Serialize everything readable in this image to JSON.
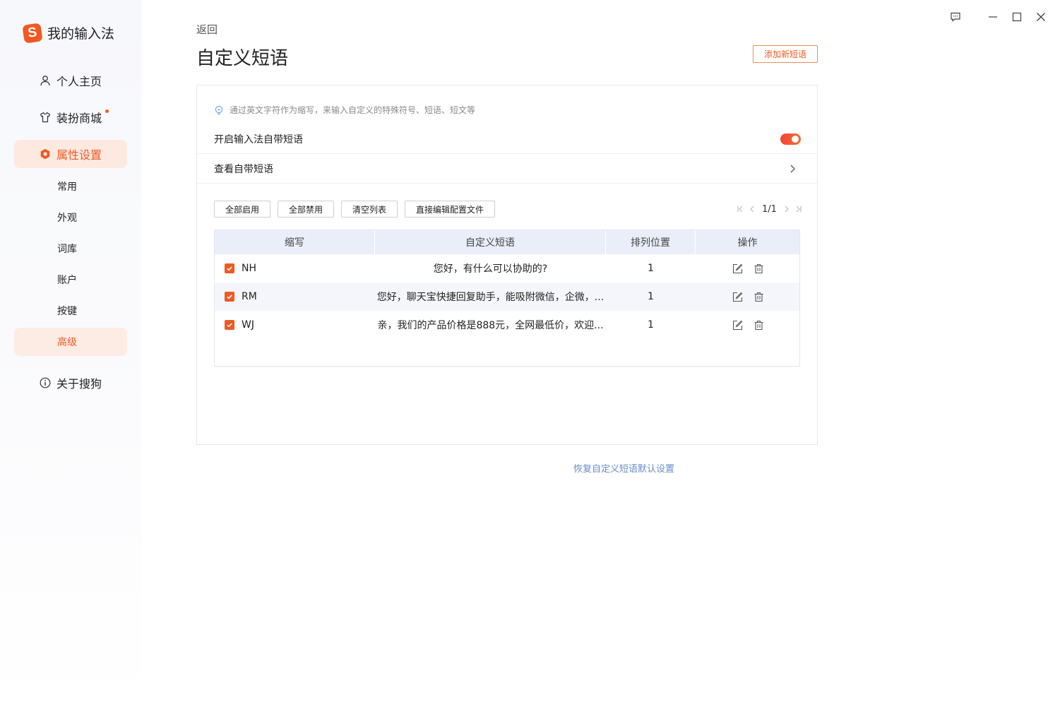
{
  "app": {
    "name": "我的输入法",
    "logo_letter": "S"
  },
  "sidebar": {
    "items": [
      {
        "label": "个人主页",
        "icon": "user-icon"
      },
      {
        "label": "装扮商城",
        "icon": "shirt-icon",
        "has_dot": true
      },
      {
        "label": "属性设置",
        "icon": "settings-hex-icon",
        "active": true
      }
    ],
    "sub_items": [
      "常用",
      "外观",
      "词库",
      "账户",
      "按键",
      "高级"
    ],
    "active_sub": "高级",
    "about": {
      "label": "关于搜狗",
      "icon": "info-icon"
    }
  },
  "header": {
    "back_label": "返回",
    "title": "自定义短语",
    "add_button": "添加新短语"
  },
  "panel": {
    "hint": "通过英文字符作为缩写，来输入自定义的特殊符号、短语、短文等",
    "enable_label": "开启输入法自带短语",
    "enable_on": true,
    "view_label": "查看自带短语"
  },
  "toolbar": {
    "enable_all": "全部启用",
    "disable_all": "全部禁用",
    "clear_list": "清空列表",
    "edit_config": "直接编辑配置文件"
  },
  "pager": {
    "text": "1/1"
  },
  "table": {
    "headers": [
      "缩写",
      "自定义短语",
      "排列位置",
      "操作"
    ],
    "rows": [
      {
        "abbr": "NH",
        "phrase": "您好，有什么可以协助的?",
        "position": "1",
        "checked": true
      },
      {
        "abbr": "RM",
        "phrase": "您好，聊天宝快捷回复助手，能吸附微信，企微，...",
        "position": "1",
        "checked": true
      },
      {
        "abbr": "WJ",
        "phrase": "亲，我们的产品价格是888元，全网最低价，欢迎...",
        "position": "1",
        "checked": true
      }
    ]
  },
  "restore_label": "恢复自定义短语默认设置",
  "colors": {
    "accent": "#f05a22",
    "link": "#6a8cc9",
    "header_bg": "#e9eef8"
  }
}
